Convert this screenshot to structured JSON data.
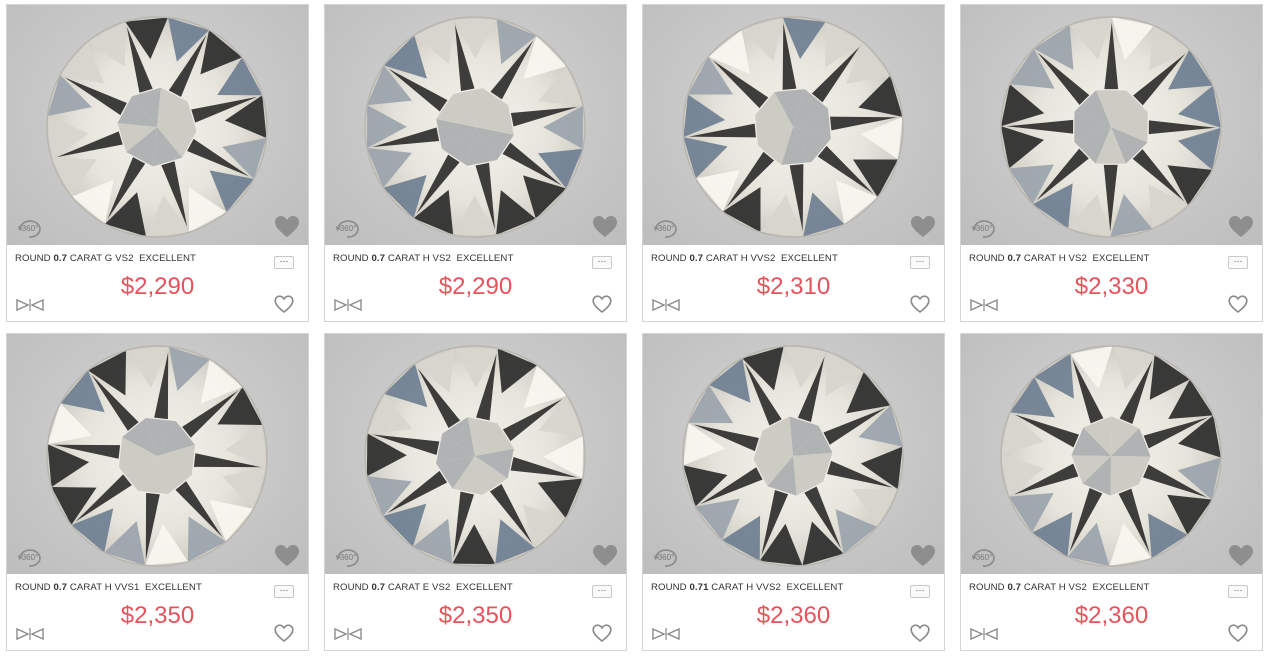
{
  "products": [
    {
      "shape": "ROUND",
      "carat": "0.7",
      "carat_word": "CARAT",
      "grade": "G VS2",
      "cut": "EXCELLENT",
      "price": "$2,290"
    },
    {
      "shape": "ROUND",
      "carat": "0.7",
      "carat_word": "CARAT",
      "grade": "H VS2",
      "cut": "EXCELLENT",
      "price": "$2,290"
    },
    {
      "shape": "ROUND",
      "carat": "0.7",
      "carat_word": "CARAT",
      "grade": "H VVS2",
      "cut": "EXCELLENT",
      "price": "$2,310"
    },
    {
      "shape": "ROUND",
      "carat": "0.7",
      "carat_word": "CARAT",
      "grade": "H VS2",
      "cut": "EXCELLENT",
      "price": "$2,330"
    },
    {
      "shape": "ROUND",
      "carat": "0.7",
      "carat_word": "CARAT",
      "grade": "H VVS1",
      "cut": "EXCELLENT",
      "price": "$2,350"
    },
    {
      "shape": "ROUND",
      "carat": "0.7",
      "carat_word": "CARAT",
      "grade": "E VS2",
      "cut": "EXCELLENT",
      "price": "$2,350"
    },
    {
      "shape": "ROUND",
      "carat": "0.71",
      "carat_word": "CARAT",
      "grade": "H VVS2",
      "cut": "EXCELLENT",
      "price": "$2,360"
    },
    {
      "shape": "ROUND",
      "carat": "0.7",
      "carat_word": "CARAT",
      "grade": "H VS2",
      "cut": "EXCELLENT",
      "price": "$2,360"
    }
  ],
  "labels": {
    "view_360": "360°",
    "more": "···"
  },
  "icons": {
    "rotate": "rotate-360-icon",
    "wishlist_photo": "heart-filled-icon",
    "more": "more-options-icon",
    "cut_grade": "bowtie-icon",
    "wishlist": "heart-outline-icon"
  },
  "colors": {
    "price": "#e8525a",
    "border": "#d4d4d4",
    "photo_bg": "#c8c8c8"
  }
}
